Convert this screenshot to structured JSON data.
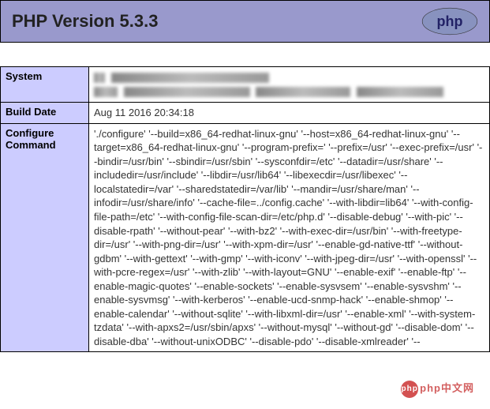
{
  "header": {
    "title": "PHP Version 5.3.3",
    "logo_label": "php"
  },
  "rows": {
    "system": {
      "label": "System",
      "value": ""
    },
    "build_date": {
      "label": "Build Date",
      "value": "Aug 11 2016 20:34:18"
    },
    "configure": {
      "label": "Configure Command",
      "value": "'./configure' '--build=x86_64-redhat-linux-gnu' '--host=x86_64-redhat-linux-gnu' '--target=x86_64-redhat-linux-gnu' '--program-prefix=' '--prefix=/usr' '--exec-prefix=/usr' '--bindir=/usr/bin' '--sbindir=/usr/sbin' '--sysconfdir=/etc' '--datadir=/usr/share' '--includedir=/usr/include' '--libdir=/usr/lib64' '--libexecdir=/usr/libexec' '--localstatedir=/var' '--sharedstatedir=/var/lib' '--mandir=/usr/share/man' '--infodir=/usr/share/info' '--cache-file=../config.cache' '--with-libdir=lib64' '--with-config-file-path=/etc' '--with-config-file-scan-dir=/etc/php.d' '--disable-debug' '--with-pic' '--disable-rpath' '--without-pear' '--with-bz2' '--with-exec-dir=/usr/bin' '--with-freetype-dir=/usr' '--with-png-dir=/usr' '--with-xpm-dir=/usr' '--enable-gd-native-ttf' '--without-gdbm' '--with-gettext' '--with-gmp' '--with-iconv' '--with-jpeg-dir=/usr' '--with-openssl' '--with-pcre-regex=/usr' '--with-zlib' '--with-layout=GNU' '--enable-exif' '--enable-ftp' '--enable-magic-quotes' '--enable-sockets' '--enable-sysvsem' '--enable-sysvshm' '--enable-sysvmsg' '--with-kerberos' '--enable-ucd-snmp-hack' '--enable-shmop' '--enable-calendar' '--without-sqlite' '--with-libxml-dir=/usr' '--enable-xml' '--with-system-tzdata' '--with-apxs2=/usr/sbin/apxs' '--without-mysql' '--without-gd' '--disable-dom' '--disable-dba' '--without-unixODBC' '--disable-pdo' '--disable-xmlreader' '--"
    }
  },
  "watermark": {
    "text": "php中文网",
    "logo": "php"
  }
}
